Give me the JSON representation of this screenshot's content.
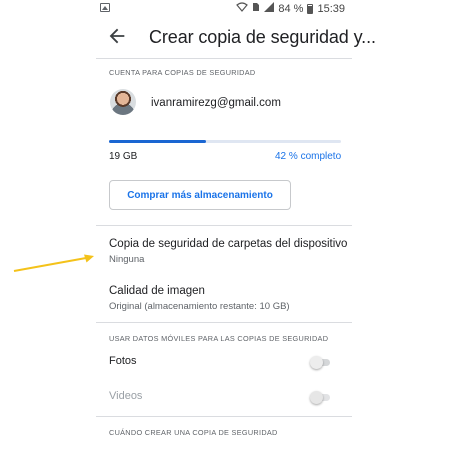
{
  "status_bar": {
    "battery_percent": "84 %",
    "time": "15:39",
    "icons": [
      "image-icon",
      "wifi-icon",
      "sim-icon",
      "signal-icon",
      "battery-icon"
    ]
  },
  "header": {
    "title": "Crear copia de seguridad y..."
  },
  "account_section": {
    "overline": "CUENTA PARA COPIAS DE SEGURIDAD",
    "email": "ivanramirezg@gmail.com",
    "storage_used": "19 GB",
    "storage_percent_label": "42 % completo",
    "storage_fraction": 0.42,
    "buy_button": "Comprar más almacenamiento"
  },
  "folders": {
    "title": "Copia de seguridad de carpetas del dispositivo",
    "value": "Ninguna"
  },
  "quality": {
    "title": "Calidad de imagen",
    "value": "Original (almacenamiento restante: 10 GB)"
  },
  "mobile_data": {
    "overline": "USAR DATOS MÓVILES PARA LAS COPIAS DE SEGURIDAD",
    "photos_label": "Fotos",
    "photos_enabled": false,
    "videos_label": "Videos",
    "videos_enabled": false
  },
  "when_section": {
    "overline": "CUÁNDO CREAR UNA COPIA DE SEGURIDAD"
  },
  "colors": {
    "accent": "#1a73e8",
    "annotation_arrow": "#f4c21a"
  }
}
